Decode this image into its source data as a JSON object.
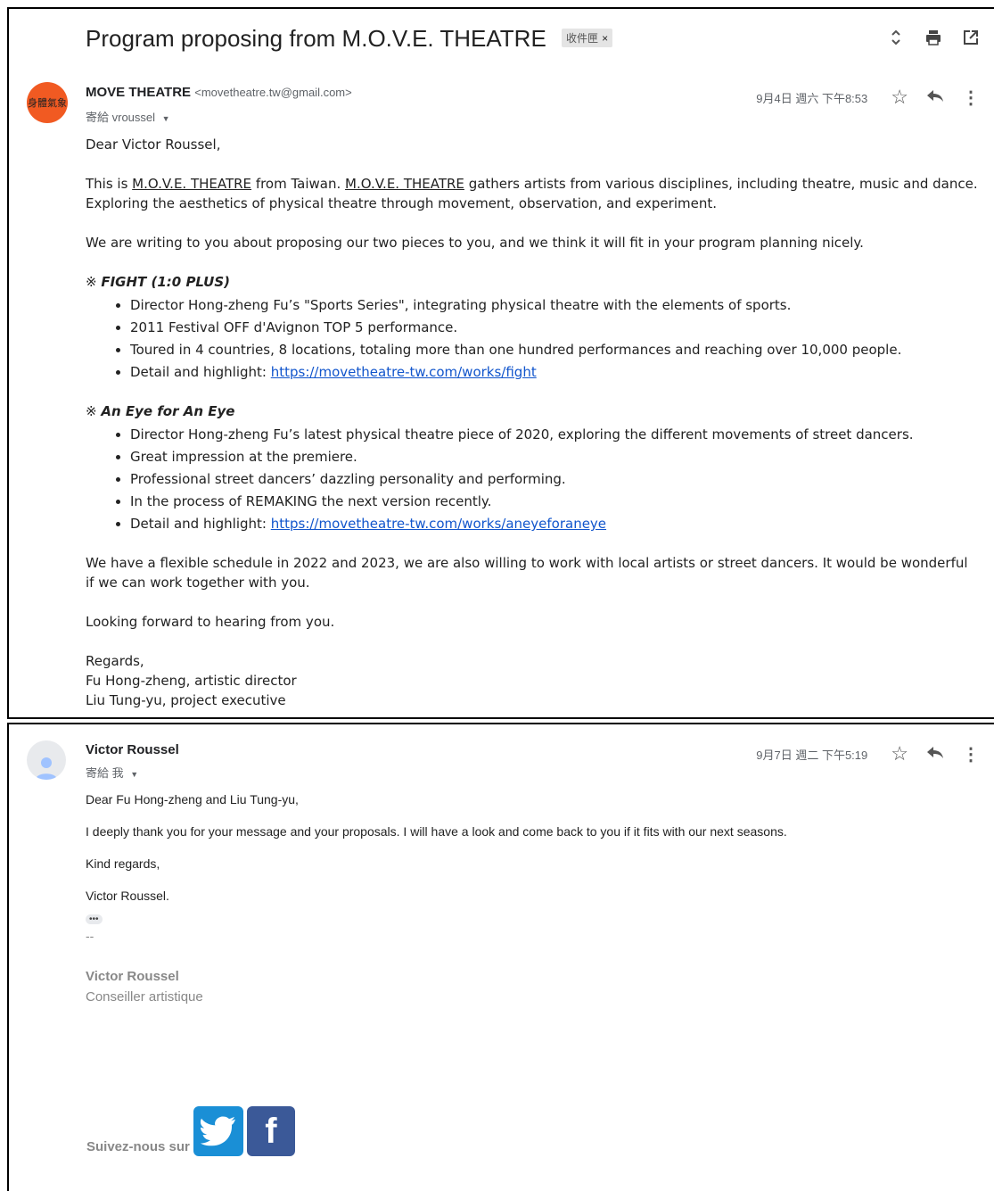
{
  "subject": "Program proposing from M.O.V.E. THEATRE",
  "label_chip": "收件匣",
  "label_close": "×",
  "header_icons": [
    "expand-collapse-icon",
    "print-icon",
    "open-in-new-window-icon"
  ],
  "message1": {
    "avatar_text": "身體氣象",
    "sender_name": "MOVE THEATRE",
    "sender_email": "<movetheatre.tw@gmail.com>",
    "to": "寄給 vroussel",
    "date": "9月4日 週六 下午8:53",
    "greeting": "Dear Victor Roussel,",
    "p1_a": "This is ",
    "p1_b": "M.O.V.E. THEATRE",
    "p1_c": " from Taiwan. ",
    "p1_d": "M.O.V.E. THEATRE",
    "p1_e": " gathers artists from various disciplines, including theatre, music and dance. Exploring the aesthetics of physical theatre through movement, observation, and experiment.",
    "p2": "We are writing to you about proposing our two pieces to you, and we think it will fit in your program planning nicely.",
    "sec1_mark": "※ ",
    "sec1_title": "FIGHT (1:0 PLUS)",
    "sec1_items": [
      "Director Hong-zheng Fu’s \"Sports Series\", integrating physical theatre with the elements of sports.",
      "2011 Festival OFF d'Avignon TOP 5 performance.",
      "Toured in 4 countries, 8 locations, totaling more than one hundred performances and reaching over 10,000 people."
    ],
    "sec1_detail_label": "Detail and highlight: ",
    "sec1_link": "https://movetheatre-tw.com/works/fight",
    "sec2_mark": "※ ",
    "sec2_title": "An Eye for An Eye",
    "sec2_items": [
      "Director Hong-zheng Fu’s latest physical theatre piece of 2020, exploring the different movements of street dancers.",
      "Great impression at the premiere.",
      "Professional street dancers’ dazzling personality and performing.",
      "In the process of REMAKING the next version recently."
    ],
    "sec2_detail_label": "Detail and highlight: ",
    "sec2_link": "https://movetheatre-tw.com/works/aneyeforaneye",
    "p3": "We have a flexible schedule in 2022 and 2023, we are also willing to work with local artists or street dancers. It would be wonderful if we can work together with you.",
    "p4": "Looking forward to hearing from you.",
    "sign1": "Regards,",
    "sign2": "Fu Hong-zheng, artistic director",
    "sign3": "Liu Tung-yu, project executive"
  },
  "message2": {
    "sender_name": "Victor Roussel",
    "to": "寄給 我",
    "date": "9月7日 週二 下午5:19",
    "greeting": "Dear Fu Hong-zheng and Liu Tung-yu,",
    "p1": "I deeply thank you for your message and your proposals. I will have a look and come back to you if it fits with our next seasons.",
    "p2": "Kind regards,",
    "p3": "Victor Roussel.",
    "dots": "•••",
    "separator": "--",
    "sig_name": "Victor Roussel",
    "sig_role": "Conseiller artistique",
    "follow": "Suivez-nous sur",
    "fb_letter": "f"
  }
}
